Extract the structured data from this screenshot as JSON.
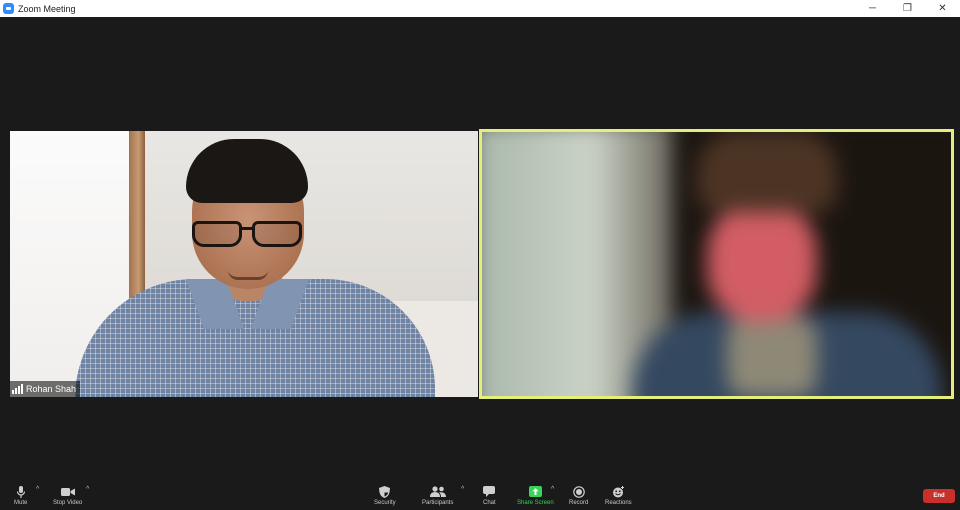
{
  "window": {
    "title": "Zoom Meeting",
    "controls": {
      "minimize": "─",
      "restore": "❐",
      "close": "✕"
    }
  },
  "participants": [
    {
      "name": "Rohan Shah",
      "active_speaker": false
    },
    {
      "name": "",
      "active_speaker": true,
      "blurred": true
    }
  ],
  "colors": {
    "active_speaker_border": "#e4ee7a",
    "share_screen": "#37d45a",
    "end": "#c9302c"
  },
  "toolbar": {
    "mute": "Mute",
    "stop_video": "Stop Video",
    "security": "Security",
    "participants": "Participants",
    "chat": "Chat",
    "share_screen": "Share Screen",
    "record": "Record",
    "reactions": "Reactions",
    "end": "End",
    "caret": "^"
  }
}
